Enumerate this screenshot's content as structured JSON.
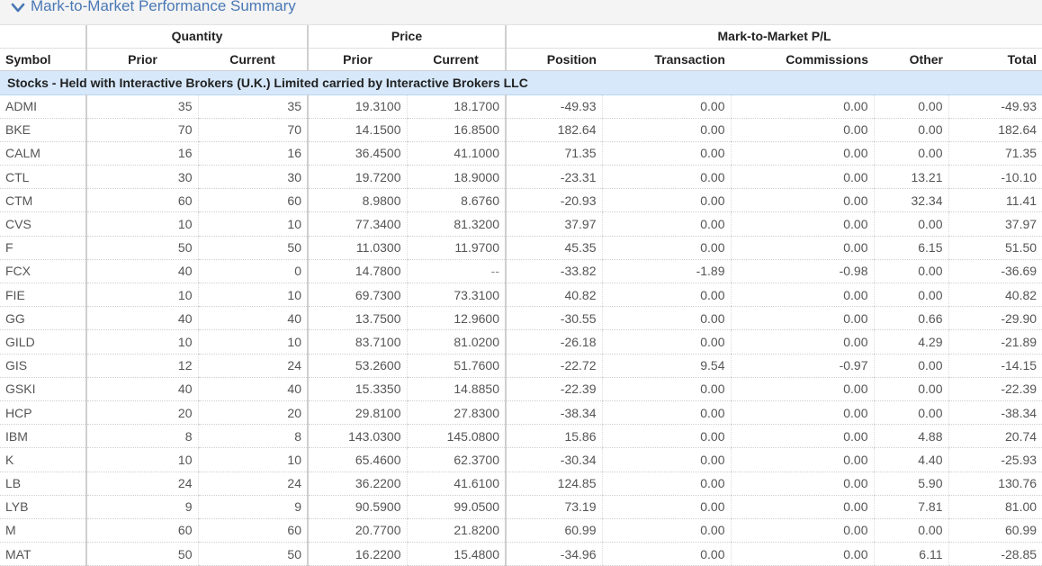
{
  "section": {
    "title": "Mark-to-Market Performance Summary",
    "toggle_icon": "chevron-down-icon",
    "accent_color": "#4a78b5"
  },
  "group_headers": {
    "quantity": "Quantity",
    "price": "Price",
    "mtm_pl": "Mark-to-Market P/L"
  },
  "columns": {
    "symbol": "Symbol",
    "qty_prior": "Prior",
    "qty_current": "Current",
    "price_prior": "Prior",
    "price_current": "Current",
    "position": "Position",
    "transaction": "Transaction",
    "commissions": "Commissions",
    "other": "Other",
    "total": "Total"
  },
  "asset_class_label": "Stocks - Held with Interactive Brokers (U.K.) Limited carried by Interactive Brokers LLC",
  "rows": [
    {
      "symbol": "ADMI",
      "qty_prior": "35",
      "qty_current": "35",
      "price_prior": "19.3100",
      "price_current": "18.1700",
      "position": "-49.93",
      "transaction": "0.00",
      "commissions": "0.00",
      "other": "0.00",
      "total": "-49.93"
    },
    {
      "symbol": "BKE",
      "qty_prior": "70",
      "qty_current": "70",
      "price_prior": "14.1500",
      "price_current": "16.8500",
      "position": "182.64",
      "transaction": "0.00",
      "commissions": "0.00",
      "other": "0.00",
      "total": "182.64"
    },
    {
      "symbol": "CALM",
      "qty_prior": "16",
      "qty_current": "16",
      "price_prior": "36.4500",
      "price_current": "41.1000",
      "position": "71.35",
      "transaction": "0.00",
      "commissions": "0.00",
      "other": "0.00",
      "total": "71.35"
    },
    {
      "symbol": "CTL",
      "qty_prior": "30",
      "qty_current": "30",
      "price_prior": "19.7200",
      "price_current": "18.9000",
      "position": "-23.31",
      "transaction": "0.00",
      "commissions": "0.00",
      "other": "13.21",
      "total": "-10.10"
    },
    {
      "symbol": "CTM",
      "qty_prior": "60",
      "qty_current": "60",
      "price_prior": "8.9800",
      "price_current": "8.6760",
      "position": "-20.93",
      "transaction": "0.00",
      "commissions": "0.00",
      "other": "32.34",
      "total": "11.41"
    },
    {
      "symbol": "CVS",
      "qty_prior": "10",
      "qty_current": "10",
      "price_prior": "77.3400",
      "price_current": "81.3200",
      "position": "37.97",
      "transaction": "0.00",
      "commissions": "0.00",
      "other": "0.00",
      "total": "37.97"
    },
    {
      "symbol": "F",
      "qty_prior": "50",
      "qty_current": "50",
      "price_prior": "11.0300",
      "price_current": "11.9700",
      "position": "45.35",
      "transaction": "0.00",
      "commissions": "0.00",
      "other": "6.15",
      "total": "51.50"
    },
    {
      "symbol": "FCX",
      "qty_prior": "40",
      "qty_current": "0",
      "price_prior": "14.7800",
      "price_current": "--",
      "position": "-33.82",
      "transaction": "-1.89",
      "commissions": "-0.98",
      "other": "0.00",
      "total": "-36.69"
    },
    {
      "symbol": "FIE",
      "qty_prior": "10",
      "qty_current": "10",
      "price_prior": "69.7300",
      "price_current": "73.3100",
      "position": "40.82",
      "transaction": "0.00",
      "commissions": "0.00",
      "other": "0.00",
      "total": "40.82"
    },
    {
      "symbol": "GG",
      "qty_prior": "40",
      "qty_current": "40",
      "price_prior": "13.7500",
      "price_current": "12.9600",
      "position": "-30.55",
      "transaction": "0.00",
      "commissions": "0.00",
      "other": "0.66",
      "total": "-29.90"
    },
    {
      "symbol": "GILD",
      "qty_prior": "10",
      "qty_current": "10",
      "price_prior": "83.7100",
      "price_current": "81.0200",
      "position": "-26.18",
      "transaction": "0.00",
      "commissions": "0.00",
      "other": "4.29",
      "total": "-21.89"
    },
    {
      "symbol": "GIS",
      "qty_prior": "12",
      "qty_current": "24",
      "price_prior": "53.2600",
      "price_current": "51.7600",
      "position": "-22.72",
      "transaction": "9.54",
      "commissions": "-0.97",
      "other": "0.00",
      "total": "-14.15"
    },
    {
      "symbol": "GSKI",
      "qty_prior": "40",
      "qty_current": "40",
      "price_prior": "15.3350",
      "price_current": "14.8850",
      "position": "-22.39",
      "transaction": "0.00",
      "commissions": "0.00",
      "other": "0.00",
      "total": "-22.39"
    },
    {
      "symbol": "HCP",
      "qty_prior": "20",
      "qty_current": "20",
      "price_prior": "29.8100",
      "price_current": "27.8300",
      "position": "-38.34",
      "transaction": "0.00",
      "commissions": "0.00",
      "other": "0.00",
      "total": "-38.34"
    },
    {
      "symbol": "IBM",
      "qty_prior": "8",
      "qty_current": "8",
      "price_prior": "143.0300",
      "price_current": "145.0800",
      "position": "15.86",
      "transaction": "0.00",
      "commissions": "0.00",
      "other": "4.88",
      "total": "20.74"
    },
    {
      "symbol": "K",
      "qty_prior": "10",
      "qty_current": "10",
      "price_prior": "65.4600",
      "price_current": "62.3700",
      "position": "-30.34",
      "transaction": "0.00",
      "commissions": "0.00",
      "other": "4.40",
      "total": "-25.93"
    },
    {
      "symbol": "LB",
      "qty_prior": "24",
      "qty_current": "24",
      "price_prior": "36.2200",
      "price_current": "41.6100",
      "position": "124.85",
      "transaction": "0.00",
      "commissions": "0.00",
      "other": "5.90",
      "total": "130.76"
    },
    {
      "symbol": "LYB",
      "qty_prior": "9",
      "qty_current": "9",
      "price_prior": "90.5900",
      "price_current": "99.0500",
      "position": "73.19",
      "transaction": "0.00",
      "commissions": "0.00",
      "other": "7.81",
      "total": "81.00"
    },
    {
      "symbol": "M",
      "qty_prior": "60",
      "qty_current": "60",
      "price_prior": "20.7700",
      "price_current": "21.8200",
      "position": "60.99",
      "transaction": "0.00",
      "commissions": "0.00",
      "other": "0.00",
      "total": "60.99"
    },
    {
      "symbol": "MAT",
      "qty_prior": "50",
      "qty_current": "50",
      "price_prior": "16.2200",
      "price_current": "15.4800",
      "position": "-34.96",
      "transaction": "0.00",
      "commissions": "0.00",
      "other": "6.11",
      "total": "-28.85"
    }
  ]
}
